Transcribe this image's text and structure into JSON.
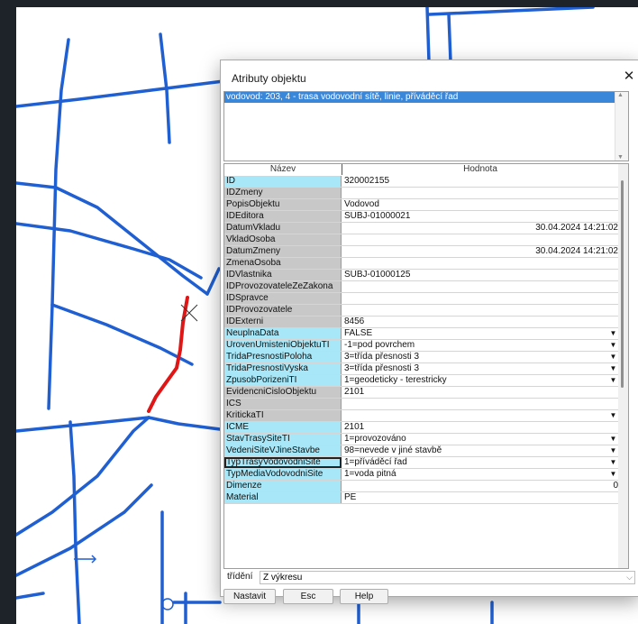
{
  "dialog": {
    "title": "Atributy objektu",
    "close_glyph": "✕",
    "selected_object": "vodovod: 203, 4 - trasa vodovodní sítě, linie, příváděcí řad",
    "columns": {
      "name": "Název",
      "value": "Hodnota"
    },
    "rows": [
      {
        "name": "ID",
        "value": "320002155",
        "req": true
      },
      {
        "name": "IDZmeny",
        "value": ""
      },
      {
        "name": "PopisObjektu",
        "value": "Vodovod"
      },
      {
        "name": "IDEditora",
        "value": "SUBJ-01000021"
      },
      {
        "name": "DatumVkladu",
        "value": "30.04.2024 14:21:02",
        "right": true
      },
      {
        "name": "VkladOsoba",
        "value": ""
      },
      {
        "name": "DatumZmeny",
        "value": "30.04.2024 14:21:02",
        "right": true
      },
      {
        "name": "ZmenaOsoba",
        "value": ""
      },
      {
        "name": "IDVlastnika",
        "value": "SUBJ-01000125"
      },
      {
        "name": "IDProvozovateleZeZakona",
        "value": ""
      },
      {
        "name": "IDSpravce",
        "value": ""
      },
      {
        "name": "IDProvozovatele",
        "value": ""
      },
      {
        "name": "IDExterni",
        "value": "8456"
      },
      {
        "name": "NeuplnaData",
        "value": "FALSE",
        "req": true,
        "dd": true
      },
      {
        "name": "UrovenUmisteniObjektuTI",
        "value": "-1=pod povrchem",
        "req": true,
        "dd": true
      },
      {
        "name": "TridaPresnostiPoloha",
        "value": "3=třída přesnosti 3",
        "req": true,
        "dd": true
      },
      {
        "name": "TridaPresnostiVyska",
        "value": "3=třída přesnosti 3",
        "req": true,
        "dd": true
      },
      {
        "name": "ZpusobPorizeniTI",
        "value": "1=geodeticky - terestricky",
        "req": true,
        "dd": true
      },
      {
        "name": "EvidencniCisloObjektu",
        "value": "2101"
      },
      {
        "name": "ICS",
        "value": ""
      },
      {
        "name": "KritickaTI",
        "value": "",
        "dd": true
      },
      {
        "name": "ICME",
        "value": "2101",
        "req": true
      },
      {
        "name": "StavTrasySiteTI",
        "value": "1=provozováno",
        "req": true,
        "dd": true
      },
      {
        "name": "VedeniSiteVJineStavbe",
        "value": "98=nevede v jiné stavbě",
        "req": true,
        "dd": true
      },
      {
        "name": "TypTrasyVodovodniSite",
        "value": "1=příváděcí řad",
        "req": true,
        "dd": true,
        "selected": true
      },
      {
        "name": "TypMediaVodovodniSite",
        "value": "1=voda pitná",
        "req": true,
        "dd": true
      },
      {
        "name": "Dimenze",
        "value": "0",
        "req": true,
        "right": true
      },
      {
        "name": "Material",
        "value": "PE",
        "req": true
      }
    ],
    "sort_label": "třídění",
    "sort_value": "Z výkresu",
    "buttons": {
      "set": "Nastavit",
      "esc": "Esc",
      "help": "Help"
    }
  },
  "colors": {
    "pipe": "#1f5fd1",
    "selected_pipe": "#e01515",
    "required_cell": "#a7e7f7",
    "optional_cell": "#c8c8c8",
    "selection": "#3a86d9"
  }
}
